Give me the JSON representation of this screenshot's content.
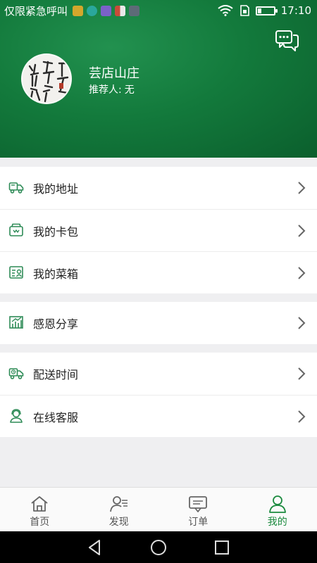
{
  "status_bar": {
    "carrier": "仅限紧急呼叫",
    "time": "17:10",
    "notification_colors": [
      "#d4a72c",
      "#2aa79b",
      "#7b61c9",
      "#c94b3a",
      "#5d6b77"
    ]
  },
  "profile": {
    "store_name": "芸店山庄",
    "referrer_label": "推荐人:",
    "referrer_value": "无"
  },
  "menu_groups": [
    [
      {
        "label": "我的地址",
        "icon": "delivery-truck-icon"
      },
      {
        "label": "我的卡包",
        "icon": "card-wallet-icon"
      },
      {
        "label": "我的菜箱",
        "icon": "produce-box-icon"
      }
    ],
    [
      {
        "label": "感恩分享",
        "icon": "share-chart-icon"
      }
    ],
    [
      {
        "label": "配送时间",
        "icon": "delivery-clock-icon"
      },
      {
        "label": "在线客服",
        "icon": "customer-service-icon"
      }
    ]
  ],
  "tabbar": [
    {
      "label": "首页",
      "icon": "home-icon",
      "active": false
    },
    {
      "label": "发现",
      "icon": "discover-user-icon",
      "active": false
    },
    {
      "label": "订单",
      "icon": "order-message-icon",
      "active": false
    },
    {
      "label": "我的",
      "icon": "profile-icon",
      "active": true
    }
  ],
  "colors": {
    "brand_green": "#1b8a3e",
    "header_dark": "#0b5f2d",
    "icon_green": "#2e8b57"
  }
}
